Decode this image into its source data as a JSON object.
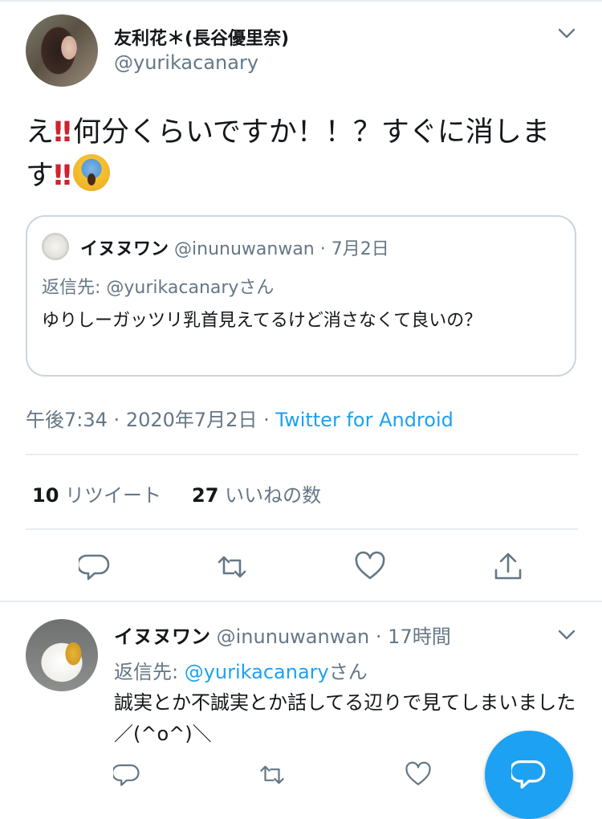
{
  "main_tweet": {
    "display_name": "友利花＊(長谷優里奈)",
    "handle": "@yurikacanary",
    "text_part1": "え",
    "emoji_bang": "‼",
    "text_part2": "何分くらいですか！！？すぐに消します",
    "emoji_scream": "scream-face-emoji",
    "quote": {
      "name": "イヌヌワン",
      "handle": "@inunuwanwan",
      "separator": "·",
      "date": "7月2日",
      "reply_to": "返信先: @yurikacanaryさん",
      "text": "ゆりしーガッツリ乳首見えてるけど消さなくて良いの？"
    },
    "time": "午後7:34",
    "date": "2020年7月2日",
    "separator": "·",
    "source": "Twitter for Android",
    "retweet_count": "10",
    "retweet_label": "リツイート",
    "like_count": "27",
    "like_label": "いいねの数"
  },
  "reply_tweet": {
    "name": "イヌヌワン",
    "handle": "@inunuwanwan",
    "separator": "·",
    "time": "17時間",
    "reply_prefix": "返信先: ",
    "reply_handle": "@yurikacanary",
    "reply_suffix": "さん",
    "text": "誠実とか不誠実とか話してる辺りで見てしまいました／(^o^)＼"
  },
  "icons": {
    "menu": "chevron-down-icon",
    "reply": "reply-icon",
    "retweet": "retweet-icon",
    "like": "heart-icon",
    "share": "share-icon",
    "compose": "compose-icon"
  },
  "colors": {
    "accent": "#1da1f2",
    "text": "#14171a",
    "secondary": "#657786",
    "divider": "#e6ecf0",
    "emoji_red": "#d0212f"
  }
}
